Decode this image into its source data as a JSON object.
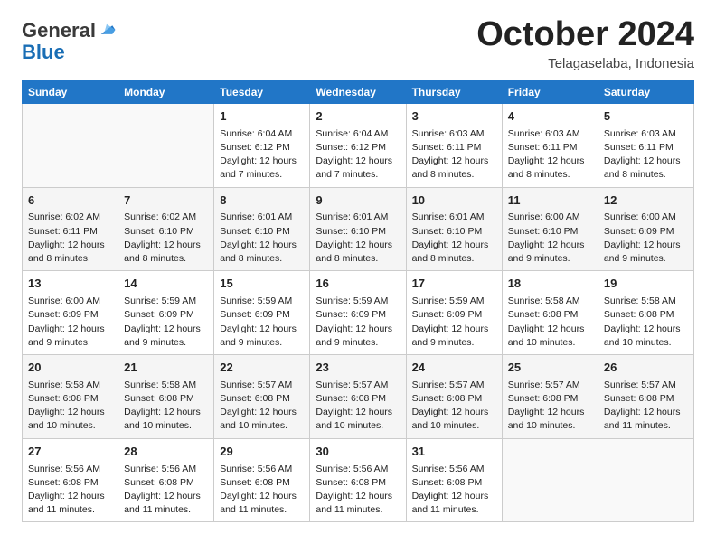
{
  "logo": {
    "general": "General",
    "blue": "Blue"
  },
  "header": {
    "month": "October 2024",
    "location": "Telagaselaba, Indonesia"
  },
  "days_of_week": [
    "Sunday",
    "Monday",
    "Tuesday",
    "Wednesday",
    "Thursday",
    "Friday",
    "Saturday"
  ],
  "weeks": [
    [
      {
        "day": "",
        "info": ""
      },
      {
        "day": "",
        "info": ""
      },
      {
        "day": "1",
        "sunrise": "Sunrise: 6:04 AM",
        "sunset": "Sunset: 6:12 PM",
        "daylight": "Daylight: 12 hours and 7 minutes."
      },
      {
        "day": "2",
        "sunrise": "Sunrise: 6:04 AM",
        "sunset": "Sunset: 6:12 PM",
        "daylight": "Daylight: 12 hours and 7 minutes."
      },
      {
        "day": "3",
        "sunrise": "Sunrise: 6:03 AM",
        "sunset": "Sunset: 6:11 PM",
        "daylight": "Daylight: 12 hours and 8 minutes."
      },
      {
        "day": "4",
        "sunrise": "Sunrise: 6:03 AM",
        "sunset": "Sunset: 6:11 PM",
        "daylight": "Daylight: 12 hours and 8 minutes."
      },
      {
        "day": "5",
        "sunrise": "Sunrise: 6:03 AM",
        "sunset": "Sunset: 6:11 PM",
        "daylight": "Daylight: 12 hours and 8 minutes."
      }
    ],
    [
      {
        "day": "6",
        "sunrise": "Sunrise: 6:02 AM",
        "sunset": "Sunset: 6:11 PM",
        "daylight": "Daylight: 12 hours and 8 minutes."
      },
      {
        "day": "7",
        "sunrise": "Sunrise: 6:02 AM",
        "sunset": "Sunset: 6:10 PM",
        "daylight": "Daylight: 12 hours and 8 minutes."
      },
      {
        "day": "8",
        "sunrise": "Sunrise: 6:01 AM",
        "sunset": "Sunset: 6:10 PM",
        "daylight": "Daylight: 12 hours and 8 minutes."
      },
      {
        "day": "9",
        "sunrise": "Sunrise: 6:01 AM",
        "sunset": "Sunset: 6:10 PM",
        "daylight": "Daylight: 12 hours and 8 minutes."
      },
      {
        "day": "10",
        "sunrise": "Sunrise: 6:01 AM",
        "sunset": "Sunset: 6:10 PM",
        "daylight": "Daylight: 12 hours and 8 minutes."
      },
      {
        "day": "11",
        "sunrise": "Sunrise: 6:00 AM",
        "sunset": "Sunset: 6:10 PM",
        "daylight": "Daylight: 12 hours and 9 minutes."
      },
      {
        "day": "12",
        "sunrise": "Sunrise: 6:00 AM",
        "sunset": "Sunset: 6:09 PM",
        "daylight": "Daylight: 12 hours and 9 minutes."
      }
    ],
    [
      {
        "day": "13",
        "sunrise": "Sunrise: 6:00 AM",
        "sunset": "Sunset: 6:09 PM",
        "daylight": "Daylight: 12 hours and 9 minutes."
      },
      {
        "day": "14",
        "sunrise": "Sunrise: 5:59 AM",
        "sunset": "Sunset: 6:09 PM",
        "daylight": "Daylight: 12 hours and 9 minutes."
      },
      {
        "day": "15",
        "sunrise": "Sunrise: 5:59 AM",
        "sunset": "Sunset: 6:09 PM",
        "daylight": "Daylight: 12 hours and 9 minutes."
      },
      {
        "day": "16",
        "sunrise": "Sunrise: 5:59 AM",
        "sunset": "Sunset: 6:09 PM",
        "daylight": "Daylight: 12 hours and 9 minutes."
      },
      {
        "day": "17",
        "sunrise": "Sunrise: 5:59 AM",
        "sunset": "Sunset: 6:09 PM",
        "daylight": "Daylight: 12 hours and 9 minutes."
      },
      {
        "day": "18",
        "sunrise": "Sunrise: 5:58 AM",
        "sunset": "Sunset: 6:08 PM",
        "daylight": "Daylight: 12 hours and 10 minutes."
      },
      {
        "day": "19",
        "sunrise": "Sunrise: 5:58 AM",
        "sunset": "Sunset: 6:08 PM",
        "daylight": "Daylight: 12 hours and 10 minutes."
      }
    ],
    [
      {
        "day": "20",
        "sunrise": "Sunrise: 5:58 AM",
        "sunset": "Sunset: 6:08 PM",
        "daylight": "Daylight: 12 hours and 10 minutes."
      },
      {
        "day": "21",
        "sunrise": "Sunrise: 5:58 AM",
        "sunset": "Sunset: 6:08 PM",
        "daylight": "Daylight: 12 hours and 10 minutes."
      },
      {
        "day": "22",
        "sunrise": "Sunrise: 5:57 AM",
        "sunset": "Sunset: 6:08 PM",
        "daylight": "Daylight: 12 hours and 10 minutes."
      },
      {
        "day": "23",
        "sunrise": "Sunrise: 5:57 AM",
        "sunset": "Sunset: 6:08 PM",
        "daylight": "Daylight: 12 hours and 10 minutes."
      },
      {
        "day": "24",
        "sunrise": "Sunrise: 5:57 AM",
        "sunset": "Sunset: 6:08 PM",
        "daylight": "Daylight: 12 hours and 10 minutes."
      },
      {
        "day": "25",
        "sunrise": "Sunrise: 5:57 AM",
        "sunset": "Sunset: 6:08 PM",
        "daylight": "Daylight: 12 hours and 10 minutes."
      },
      {
        "day": "26",
        "sunrise": "Sunrise: 5:57 AM",
        "sunset": "Sunset: 6:08 PM",
        "daylight": "Daylight: 12 hours and 11 minutes."
      }
    ],
    [
      {
        "day": "27",
        "sunrise": "Sunrise: 5:56 AM",
        "sunset": "Sunset: 6:08 PM",
        "daylight": "Daylight: 12 hours and 11 minutes."
      },
      {
        "day": "28",
        "sunrise": "Sunrise: 5:56 AM",
        "sunset": "Sunset: 6:08 PM",
        "daylight": "Daylight: 12 hours and 11 minutes."
      },
      {
        "day": "29",
        "sunrise": "Sunrise: 5:56 AM",
        "sunset": "Sunset: 6:08 PM",
        "daylight": "Daylight: 12 hours and 11 minutes."
      },
      {
        "day": "30",
        "sunrise": "Sunrise: 5:56 AM",
        "sunset": "Sunset: 6:08 PM",
        "daylight": "Daylight: 12 hours and 11 minutes."
      },
      {
        "day": "31",
        "sunrise": "Sunrise: 5:56 AM",
        "sunset": "Sunset: 6:08 PM",
        "daylight": "Daylight: 12 hours and 11 minutes."
      },
      {
        "day": "",
        "info": ""
      },
      {
        "day": "",
        "info": ""
      }
    ]
  ]
}
